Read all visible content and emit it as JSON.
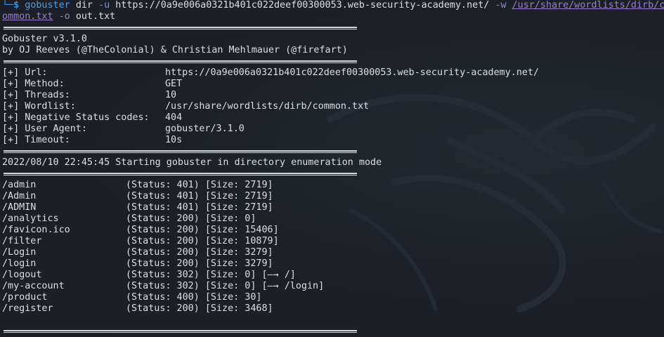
{
  "command": {
    "corner": "└─",
    "dollar": "$",
    "program": "gobuster",
    "subcommand": "dir",
    "flag_u": "-u",
    "url": "https://0a9e006a0321b401c022deef00300053.web-security-academy.net/",
    "flag_w": "-w",
    "wordlist_part1": "/usr/share/wordlists/dirb/c",
    "wordlist_part2": "ommon.txt",
    "flag_o": "-o",
    "output": "out.txt"
  },
  "banner": {
    "version": "Gobuster v3.1.0",
    "authors": "by OJ Reeves (@TheColonial) & Christian Mehlmauer (@firefart)"
  },
  "config": [
    {
      "label": "[+] Url:",
      "value": "https://0a9e006a0321b401c022deef00300053.web-security-academy.net/"
    },
    {
      "label": "[+] Method:",
      "value": "GET"
    },
    {
      "label": "[+] Threads:",
      "value": "10"
    },
    {
      "label": "[+] Wordlist:",
      "value": "/usr/share/wordlists/dirb/common.txt"
    },
    {
      "label": "[+] Negative Status codes:",
      "value": "404"
    },
    {
      "label": "[+] User Agent:",
      "value": "gobuster/3.1.0"
    },
    {
      "label": "[+] Timeout:",
      "value": "10s"
    }
  ],
  "start_message": "2022/08/10 22:45:45 Starting gobuster in directory enumeration mode",
  "results": [
    {
      "path": "/admin",
      "info": "(Status: 401) [Size: 2719]"
    },
    {
      "path": "/Admin",
      "info": "(Status: 401) [Size: 2719]"
    },
    {
      "path": "/ADMIN",
      "info": "(Status: 401) [Size: 2719]"
    },
    {
      "path": "/analytics",
      "info": "(Status: 200) [Size: 0]"
    },
    {
      "path": "/favicon.ico",
      "info": "(Status: 200) [Size: 15406]"
    },
    {
      "path": "/filter",
      "info": "(Status: 200) [Size: 10879]"
    },
    {
      "path": "/Login",
      "info": "(Status: 200) [Size: 3279]"
    },
    {
      "path": "/login",
      "info": "(Status: 200) [Size: 3279]"
    },
    {
      "path": "/logout",
      "info": "(Status: 302) [Size: 0] [—→ /]"
    },
    {
      "path": "/my-account",
      "info": "(Status: 302) [Size: 0] [—→ /login]"
    },
    {
      "path": "/product",
      "info": "(Status: 400) [Size: 30]"
    },
    {
      "path": "/register",
      "info": "(Status: 200) [Size: 3468]"
    }
  ]
}
